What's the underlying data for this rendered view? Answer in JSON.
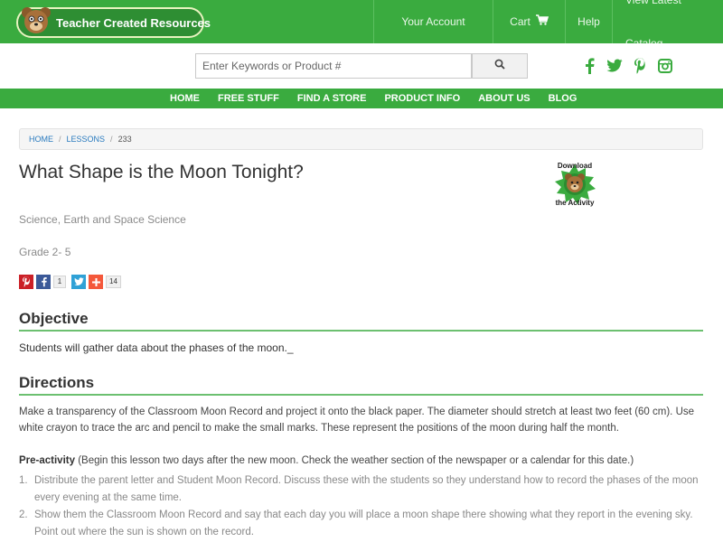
{
  "header": {
    "brand": "Teacher Created Resources",
    "nav": [
      {
        "label": "Your Account"
      },
      {
        "label": "Cart"
      },
      {
        "label": "Help"
      },
      {
        "label": "View Latest Catalog"
      }
    ]
  },
  "search": {
    "placeholder": "Enter Keywords or Product #"
  },
  "social": [
    "facebook-icon",
    "twitter-icon",
    "pinterest-icon",
    "instagram-icon"
  ],
  "main_nav": [
    {
      "label": "HOME"
    },
    {
      "label": "FREE STUFF"
    },
    {
      "label": "FIND A STORE"
    },
    {
      "label": "PRODUCT INFO"
    },
    {
      "label": "ABOUT US"
    },
    {
      "label": "BLOG"
    }
  ],
  "breadcrumb": {
    "home": "HOME",
    "lessons": "LESSONS",
    "current": "233",
    "sep": "/"
  },
  "lesson": {
    "title": "What Shape is the Moon Tonight?",
    "download_badge": {
      "line1": "Download",
      "line2": "the Activity"
    },
    "subject": "Science, Earth and Space Science",
    "grade": "Grade 2- 5",
    "share": {
      "facebook_count": "1",
      "addthis_count": "14"
    },
    "objective_heading": "Objective",
    "objective_text": "Students will gather data about the phases of the moon._",
    "directions_heading": "Directions",
    "directions_text": "Make a transparency of the Classroom Moon Record and project it onto the black paper. The diameter should stretch at least two feet (60 cm). Use white crayon to trace the arc and pencil to make the small marks. These represent the positions of the moon during half the month.",
    "preactivity_label": "Pre-activity",
    "preactivity_text": " (Begin this lesson two days after the new moon. Check the weather section of the newspaper or a calendar for this date.)",
    "steps": [
      {
        "num": "1.",
        "text": "Distribute the parent letter and Student Moon Record. Discuss these with the students so they understand how to record the phases of the moon every evening at the same time."
      },
      {
        "num": "2.",
        "text": "Show them the Classroom Moon Record and say that each day you will place a moon shape there showing what they report in the evening sky. Point out where the sun is shown on the record."
      }
    ]
  },
  "colors": {
    "brand_green": "#3aab3f",
    "link_blue": "#2a7bbf",
    "rule_green": "#6cc070"
  }
}
